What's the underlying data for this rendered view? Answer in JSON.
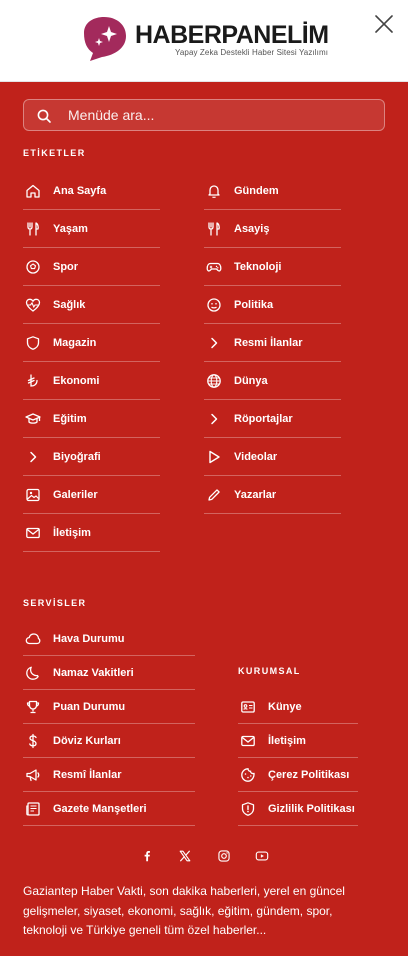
{
  "brand": {
    "name": "HABERPANELİM",
    "tagline": "Yapay Zeka Destekli Haber Sitesi Yazılımı",
    "accent": "#c0221b",
    "logo_color": "#a32a5c"
  },
  "search": {
    "placeholder": "Menüde ara..."
  },
  "tags": {
    "title": "ETİKETLER",
    "left": [
      {
        "label": "Ana Sayfa",
        "icon": "home-icon"
      },
      {
        "label": "Yaşam",
        "icon": "utensils-icon"
      },
      {
        "label": "Spor",
        "icon": "soccer-ball-icon"
      },
      {
        "label": "Sağlık",
        "icon": "heart-pulse-icon"
      },
      {
        "label": "Magazin",
        "icon": "shield-icon"
      },
      {
        "label": "Ekonomi",
        "icon": "lira-icon"
      },
      {
        "label": "Eğitim",
        "icon": "graduation-cap-icon"
      },
      {
        "label": "Biyoğrafi",
        "icon": "chevron-right-icon"
      },
      {
        "label": "Galeriler",
        "icon": "image-icon"
      },
      {
        "label": "İletişim",
        "icon": "mail-icon"
      }
    ],
    "right": [
      {
        "label": "Gündem",
        "icon": "bell-icon"
      },
      {
        "label": "Asayiş",
        "icon": "utensils-icon"
      },
      {
        "label": "Teknoloji",
        "icon": "gamepad-icon"
      },
      {
        "label": "Politika",
        "icon": "smile-icon"
      },
      {
        "label": "Resmi İlanlar",
        "icon": "chevron-right-icon"
      },
      {
        "label": "Dünya",
        "icon": "globe-icon"
      },
      {
        "label": "Röportajlar",
        "icon": "chevron-right-icon"
      },
      {
        "label": "Videolar",
        "icon": "play-icon"
      },
      {
        "label": "Yazarlar",
        "icon": "pencil-icon"
      }
    ]
  },
  "services": {
    "title": "SERVİSLER",
    "items": [
      {
        "label": "Hava Durumu",
        "icon": "cloud-icon"
      },
      {
        "label": "Namaz Vakitleri",
        "icon": "moon-icon"
      },
      {
        "label": "Puan Durumu",
        "icon": "trophy-icon"
      },
      {
        "label": "Döviz Kurları",
        "icon": "dollar-icon"
      },
      {
        "label": "Resmî İlanlar",
        "icon": "megaphone-icon"
      },
      {
        "label": "Gazete Manşetleri",
        "icon": "newspaper-icon"
      }
    ]
  },
  "corporate": {
    "title": "KURUMSAL",
    "items": [
      {
        "label": "Künye",
        "icon": "id-card-icon"
      },
      {
        "label": "İletişim",
        "icon": "mail-icon"
      },
      {
        "label": "Çerez Politikası",
        "icon": "cookie-icon"
      },
      {
        "label": "Gizlilik Politikası",
        "icon": "shield-alert-icon"
      }
    ]
  },
  "social": [
    "facebook-icon",
    "x-icon",
    "instagram-icon",
    "youtube-icon"
  ],
  "about": "Gaziantep Haber Vakti, son dakika haberleri, yerel en güncel gelişmeler, siyaset, ekonomi, sağlık, eğitim, gündem, spor, teknoloji ve Türkiye geneli tüm özel haberler..."
}
